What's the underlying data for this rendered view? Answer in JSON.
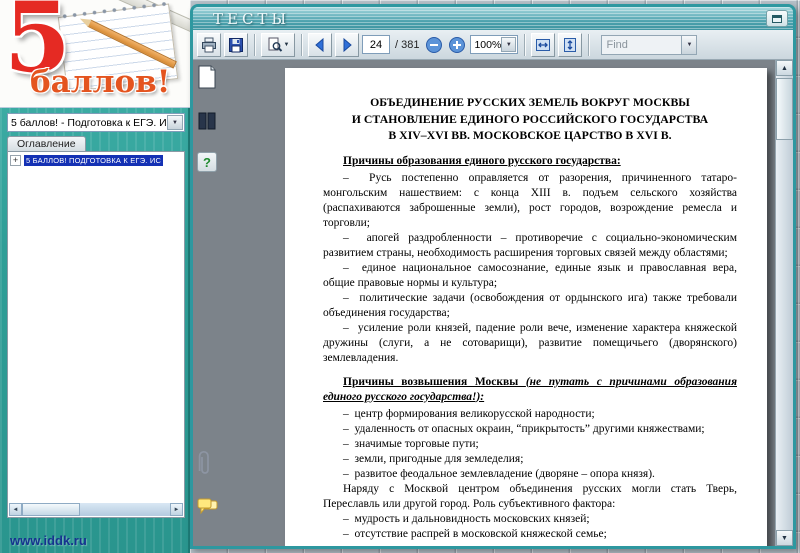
{
  "colors": {
    "accent_teal": "#2e98a0",
    "sidebar_teal": "#2f9e97",
    "selection_blue": "#1431b4",
    "logo_red": "#e52a23",
    "document_area_gray": "#7c838a"
  },
  "sidebar": {
    "logo_numeral": "5",
    "logo_word": "баллов!",
    "edition_select_value": "5 баллов! - Подготовка к ЕГЭ. Ис",
    "contents_tab": "Оглавление",
    "tree_items": [
      {
        "expander": "+",
        "label": "5 БАЛЛОВ! ПОДГОТОВКА К ЕГЭ. ИС"
      }
    ],
    "site_link": "www.iddk.ru"
  },
  "window": {
    "title": "ТЕСТЫ",
    "toolbar": {
      "page_value": "24",
      "page_total": "/ 381",
      "zoom_value": "100%",
      "find_placeholder": "Find"
    }
  },
  "doc": {
    "title_lines": [
      "ОБЪЕДИНЕНИЕ РУССКИХ ЗЕМЕЛЬ ВОКРУГ МОСКВЫ",
      "И СТАНОВЛЕНИЕ ЕДИНОГО РОССИЙСКОГО ГОСУДАРСТВА",
      "В XIV–XVI ВВ. МОСКОВСКОЕ ЦАРСТВО В XVI В."
    ],
    "heading1": "Причины образования единого русского государства:",
    "items1": [
      "–  Русь постепенно оправляется от разорения, причиненного татаро-монгольским нашествием: с конца XIII в. подъем сельского хозяйства (распахиваются заброшенные земли), рост городов, возрождение ремесла и торговли;",
      "–  апогей раздробленности – противоречие с социально-экономическим развитием страны, необходимость расширения торговых связей между областями;",
      "–  единое национальное самосознание, единые язык и православная вера, общие правовые нормы и культура;",
      "–  политические задачи (освобождения от ордынского ига) также требовали объединения государства;",
      "–  усиление роли князей, падение роли вече, изменение характера княжеской дружины (слуги, а не сотоварищи), развитие помещичьего (дворянского) землевладения."
    ],
    "heading2_main": "Причины возвышения Москвы ",
    "heading2_note": "(не путать с причинами образования единого русского государства!):",
    "items2": [
      "–  центр формирования великорусской народности;",
      "–  удаленность от опасных окраин, “прикрытость” другими княжествами;",
      "–  значимые торговые пути;",
      "–  земли, пригодные для земледелия;",
      "–  развитое феодальное землевладение (дворяне – опора князя)."
    ],
    "closing_paragraph": "Наряду с Москвой центром объединения русских могли стать Тверь, Переславль или другой город. Роль субъективного фактора:",
    "items3": [
      "–  мудрость и дальновидность московских князей;",
      "–  отсутствие распрей в московской княжеской семье;"
    ]
  }
}
